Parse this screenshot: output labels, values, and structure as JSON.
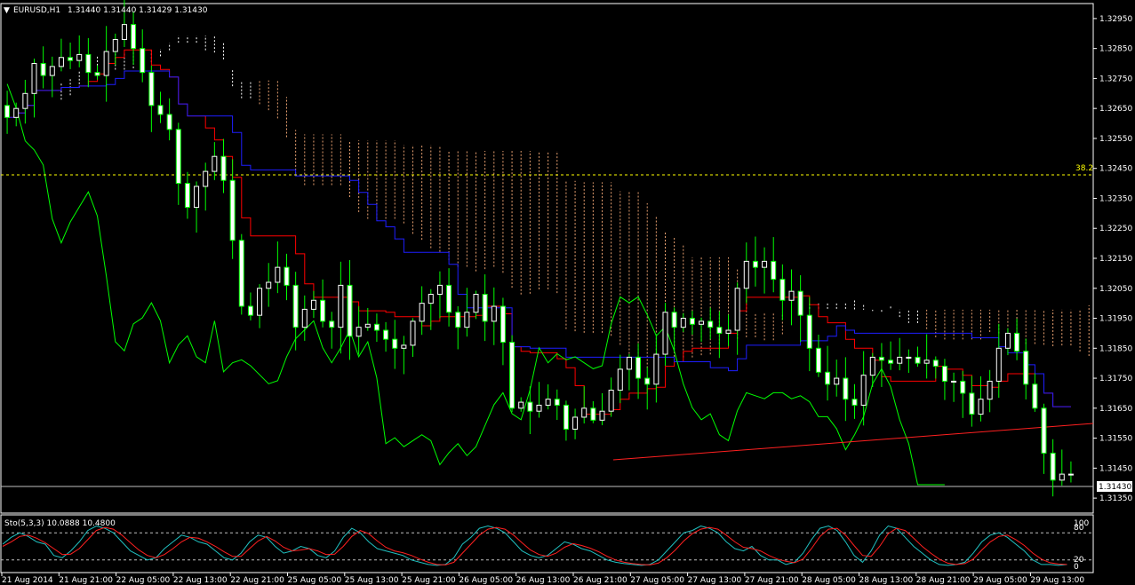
{
  "header": {
    "symbol": "EURUSD,H1",
    "ohlc": "1.31440 1.31440 1.31429 1.31430"
  },
  "indicator": {
    "label": "Sto(5,3,3) 10.0888 10.4800",
    "levels": [
      "100",
      "80",
      "20",
      "0"
    ]
  },
  "fib_label": "38.2",
  "current_price_label": "1.31430",
  "colors": {
    "background": "#000000",
    "frame": "#ffffff",
    "bull": "#ffffff",
    "bear": "#00ff00",
    "tenkan": "#ff0000",
    "kijun": "#1e1eff",
    "chikou": "#00ff00",
    "cloud_a": "#ffffff",
    "cloud_b": "#e8a070",
    "fib": "#ffff00",
    "trend": "#ff2020",
    "stoch_main": "#20c0c0",
    "stoch_signal": "#ff2020"
  },
  "chart_data": [
    {
      "type": "candlestick",
      "title": "EURUSD,H1",
      "y_ticks": [
        "1.32950",
        "1.32850",
        "1.32750",
        "1.32650",
        "1.32550",
        "1.32450",
        "1.32350",
        "1.32250",
        "1.32150",
        "1.32050",
        "1.31950",
        "1.31850",
        "1.31750",
        "1.31650",
        "1.31550",
        "1.31450",
        "1.31350"
      ],
      "ylim": [
        1.313,
        1.33
      ],
      "x_ticks": [
        "21 Aug 2014",
        "21 Aug 21:00",
        "22 Aug 05:00",
        "22 Aug 13:00",
        "22 Aug 21:00",
        "25 Aug 05:00",
        "25 Aug 13:00",
        "25 Aug 21:00",
        "26 Aug 05:00",
        "26 Aug 13:00",
        "26 Aug 21:00",
        "27 Aug 05:00",
        "27 Aug 13:00",
        "27 Aug 21:00",
        "28 Aug 05:00",
        "28 Aug 13:00",
        "28 Aug 21:00",
        "29 Aug 05:00",
        "29 Aug 13:00"
      ],
      "close_path": [
        1.3262,
        1.3265,
        1.327,
        1.328,
        1.3276,
        1.3279,
        1.3282,
        1.3281,
        1.3283,
        1.3277,
        1.3276,
        1.3284,
        1.3288,
        1.3293,
        1.3285,
        1.3277,
        1.3266,
        1.3263,
        1.3258,
        1.324,
        1.3232,
        1.3239,
        1.3244,
        1.3249,
        1.3241,
        1.3221,
        1.3199,
        1.3196,
        1.3205,
        1.3207,
        1.3212,
        1.3206,
        1.3192,
        1.3198,
        1.3201,
        1.3194,
        1.3192,
        1.3206,
        1.3189,
        1.3192,
        1.3193,
        1.3191,
        1.3188,
        1.3185,
        1.3186,
        1.3194,
        1.32,
        1.3203,
        1.3206,
        1.3197,
        1.3192,
        1.3197,
        1.3203,
        1.3194,
        1.3199,
        1.3187,
        1.3165,
        1.3167,
        1.3164,
        1.3166,
        1.3168,
        1.3166,
        1.3158,
        1.3162,
        1.3165,
        1.3161,
        1.3164,
        1.3171,
        1.3178,
        1.3182,
        1.3175,
        1.3173,
        1.3183,
        1.3197,
        1.3192,
        1.3195,
        1.3193,
        1.3194,
        1.3192,
        1.319,
        1.3191,
        1.3205,
        1.3214,
        1.3212,
        1.3214,
        1.3208,
        1.3201,
        1.3204,
        1.3196,
        1.3185,
        1.3177,
        1.3173,
        1.3175,
        1.3168,
        1.3166,
        1.3176,
        1.3182,
        1.3181,
        1.318,
        1.3182,
        1.3182,
        1.318,
        1.3181,
        1.3179,
        1.3174,
        1.3174,
        1.317,
        1.3163,
        1.3168,
        1.3174,
        1.3185,
        1.319,
        1.3184,
        1.3173,
        1.3165,
        1.315,
        1.3141,
        1.3143,
        1.3143
      ]
    },
    {
      "type": "line",
      "title": "Sto(5,3,3) 10.0888 10.4800",
      "ylim": [
        0,
        100
      ],
      "levels": [
        20,
        80
      ],
      "series": [
        {
          "name": "main",
          "values": [
            55,
            70,
            80,
            72,
            60,
            55,
            30,
            25,
            40,
            60,
            85,
            95,
            90,
            80,
            60,
            40,
            30,
            20,
            25,
            45,
            60,
            75,
            70,
            60,
            55,
            40,
            25,
            20,
            35,
            60,
            75,
            70,
            50,
            35,
            40,
            50,
            45,
            30,
            25,
            40,
            70,
            90,
            80,
            60,
            45,
            40,
            35,
            30,
            20,
            15,
            10,
            8,
            10,
            25,
            55,
            70,
            90,
            95,
            90,
            80,
            60,
            40,
            30,
            25,
            30,
            45,
            60,
            55,
            45,
            40,
            30,
            20,
            15,
            12,
            10,
            8,
            10,
            20,
            40,
            60,
            80,
            85,
            95,
            90,
            80,
            60,
            45,
            40,
            50,
            30,
            20,
            20,
            10,
            15,
            35,
            65,
            90,
            95,
            85,
            60,
            30,
            15,
            40,
            75,
            95,
            90,
            70,
            50,
            35,
            20,
            10,
            8,
            10,
            15,
            35,
            60,
            75,
            80,
            70,
            55,
            40,
            20,
            10,
            10,
            8,
            10
          ]
        },
        {
          "name": "signal",
          "values": [
            50,
            60,
            72,
            75,
            68,
            58,
            45,
            32,
            33,
            45,
            65,
            85,
            92,
            88,
            75,
            58,
            42,
            30,
            25,
            32,
            45,
            60,
            70,
            68,
            60,
            50,
            38,
            28,
            28,
            45,
            62,
            72,
            62,
            48,
            40,
            42,
            45,
            40,
            32,
            33,
            50,
            72,
            85,
            78,
            62,
            48,
            40,
            36,
            30,
            22,
            15,
            10,
            9,
            15,
            35,
            55,
            75,
            88,
            92,
            88,
            75,
            58,
            42,
            32,
            28,
            35,
            48,
            56,
            52,
            46,
            38,
            28,
            20,
            15,
            12,
            10,
            9,
            13,
            25,
            42,
            62,
            78,
            88,
            92,
            88,
            75,
            60,
            48,
            45,
            40,
            30,
            22,
            17,
            14,
            22,
            45,
            72,
            88,
            90,
            75,
            52,
            30,
            28,
            50,
            78,
            90,
            85,
            68,
            50,
            35,
            22,
            13,
            10,
            12,
            22,
            42,
            60,
            72,
            75,
            65,
            52,
            35,
            22,
            14,
            11,
            10
          ]
        }
      ]
    }
  ]
}
